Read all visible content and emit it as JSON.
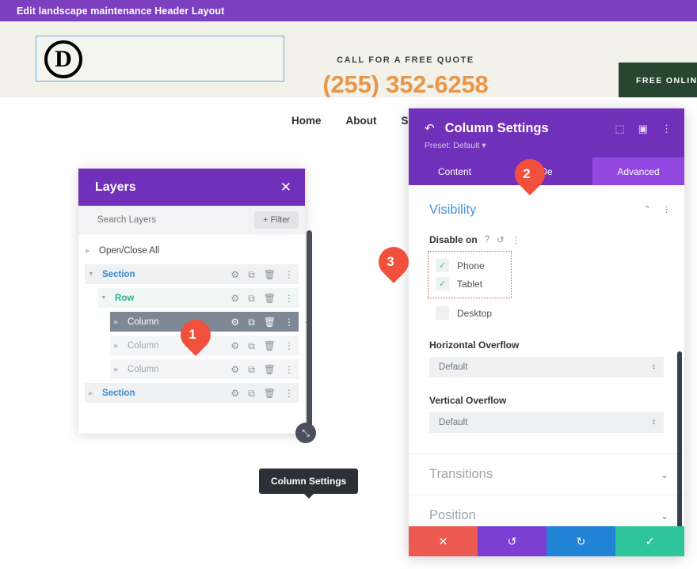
{
  "editor_bar": {
    "title": "Edit landscape maintenance Header Layout"
  },
  "site_header": {
    "logo_letter": "D",
    "call_label": "CALL FOR A FREE QUOTE",
    "phone": "(255) 352-6258",
    "cta_label": "FREE ONLINE",
    "nav": [
      "Home",
      "About",
      "Se"
    ]
  },
  "layers_panel": {
    "title": "Layers",
    "close_icon": "✕",
    "search_placeholder": "Search Layers",
    "filter_label": "+ Filter",
    "tooltip": "Column Settings",
    "resize_icon": "⤡",
    "rows": [
      {
        "label": "Open/Close All",
        "type": "openclose",
        "triangle": "▶",
        "actions": []
      },
      {
        "label": "Section",
        "type": "section",
        "triangle": "▼",
        "actions": [
          "⚙",
          "⧉",
          "🗑",
          "⋮"
        ]
      },
      {
        "label": "Row",
        "type": "row",
        "triangle": "▼",
        "actions": [
          "⚙",
          "⧉",
          "🗑",
          "⋮"
        ]
      },
      {
        "label": "Column",
        "type": "column-selected",
        "triangle": "▶",
        "actions": [
          "⚙",
          "⧉",
          "🗑",
          "⋮"
        ],
        "add": "+"
      },
      {
        "label": "Column",
        "type": "column",
        "triangle": "▶",
        "actions": [
          "⚙",
          "⧉",
          "🗑",
          "⋮"
        ]
      },
      {
        "label": "Column",
        "type": "column",
        "triangle": "▶",
        "actions": [
          "⚙",
          "⧉",
          "🗑",
          "⋮"
        ]
      },
      {
        "label": "Section",
        "type": "section",
        "triangle": "▶",
        "actions": [
          "⚙",
          "⧉",
          "🗑",
          "⋮"
        ]
      }
    ]
  },
  "column_settings": {
    "back_icon": "↶",
    "title": "Column Settings",
    "preset": "Preset: Default ▾",
    "head_icons": [
      "⬚",
      "▣",
      "⋮"
    ],
    "tabs": [
      {
        "label": "Content",
        "active": false
      },
      {
        "label": "De",
        "active": false
      },
      {
        "label": "Advanced",
        "active": true
      }
    ],
    "visibility": {
      "title": "Visibility",
      "collapse_icon": "⌃",
      "options_icon": "⋮",
      "field_label": "Disable on",
      "help_icon": "?",
      "reset_icon": "↺",
      "more_icon": "⋮",
      "checkboxes": [
        {
          "label": "Phone",
          "checked": true,
          "mark": "✓"
        },
        {
          "label": "Tablet",
          "checked": true,
          "mark": "✓"
        },
        {
          "label": "Desktop",
          "checked": false,
          "mark": "✓"
        }
      ]
    },
    "horizontal_overflow": {
      "label": "Horizontal Overflow",
      "value": "Default",
      "arrows": "↕"
    },
    "vertical_overflow": {
      "label": "Vertical Overflow",
      "value": "Default",
      "arrows": "↕"
    },
    "collapsed_sections": [
      {
        "label": "Transitions",
        "chevron": "⌄"
      },
      {
        "label": "Position",
        "chevron": "⌄"
      }
    ],
    "actions": [
      {
        "name": "cancel",
        "icon": "✕"
      },
      {
        "name": "undo",
        "icon": "↺"
      },
      {
        "name": "redo",
        "icon": "↻"
      },
      {
        "name": "save",
        "icon": "✓"
      }
    ]
  },
  "markers": [
    {
      "number": "1"
    },
    {
      "number": "2"
    },
    {
      "number": "3"
    }
  ]
}
